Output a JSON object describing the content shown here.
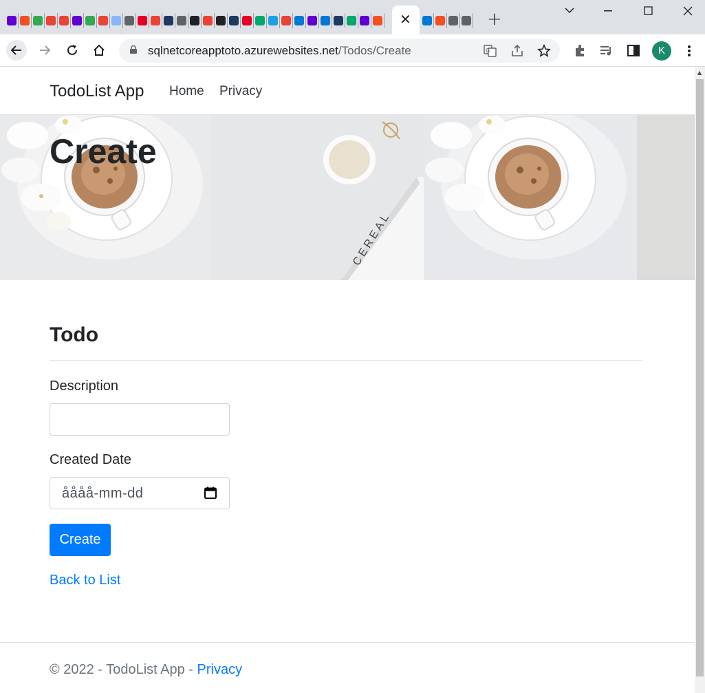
{
  "browser": {
    "close_tab_glyph": "✕",
    "new_tab_glyph": "+",
    "url_host": "sqlnetcoreapptoto.azurewebsites.net",
    "url_path": "/Todos/Create",
    "profile_initial": "K",
    "tab_favicon_colors": [
      "#6001d2",
      "#f25022",
      "#34a853",
      "#ea4335",
      "#ea4335",
      "#6001d2",
      "#34a853",
      "#ea4335",
      "#8ab4f8",
      "#5f6368",
      "#e60023",
      "#ea4335",
      "#1e3a5f",
      "#5f6368",
      "#202124",
      "#ea4335",
      "#202124",
      "#1e3a5f",
      "#e60023",
      "#00a86b",
      "#1ba1e2",
      "#ea4335",
      "#0078d4",
      "#6001d2",
      "#0078d4",
      "#1e3a5f",
      "#00a86b",
      "#6001d2",
      "#f25022"
    ],
    "tab_favicon_colors_right": [
      "#0078d4",
      "#f25022",
      "#5f6368",
      "#5f6368"
    ]
  },
  "app": {
    "brand": "TodoList App",
    "nav": [
      "Home",
      "Privacy"
    ]
  },
  "hero": {
    "title": "Create"
  },
  "form": {
    "section_title": "Todo",
    "description_label": "Description",
    "description_value": "",
    "created_date_label": "Created Date",
    "created_date_placeholder": "åååå-mm-dd",
    "submit_label": "Create",
    "back_link": "Back to List"
  },
  "footer": {
    "text": "© 2022 - TodoList App - ",
    "privacy_link": "Privacy"
  },
  "colors": {
    "primary": "#007bff",
    "text": "#212529",
    "muted": "#6c757d"
  }
}
